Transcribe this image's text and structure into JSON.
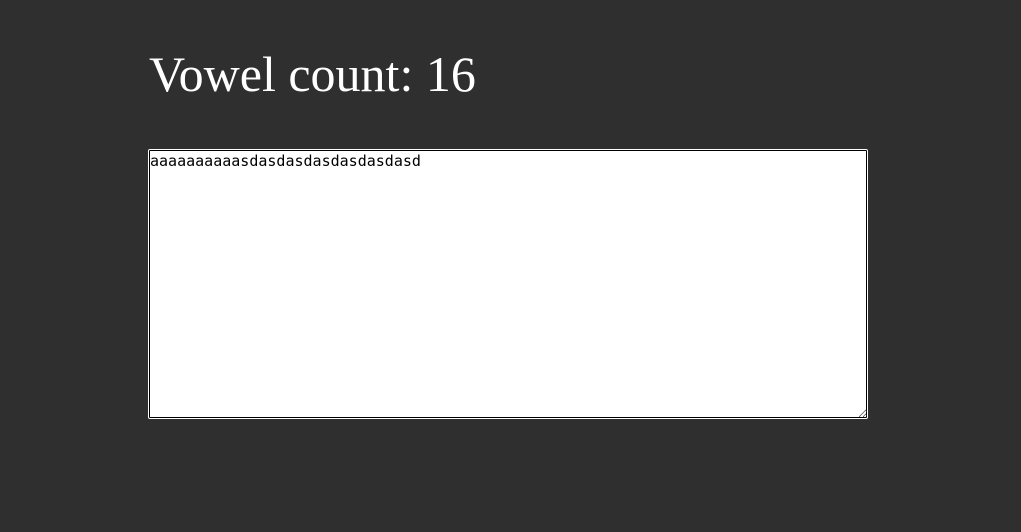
{
  "heading": {
    "label": "Vowel count:",
    "count": "16"
  },
  "input": {
    "value": "aaaaaaaaaasdasdasdasdasdasdasd"
  }
}
